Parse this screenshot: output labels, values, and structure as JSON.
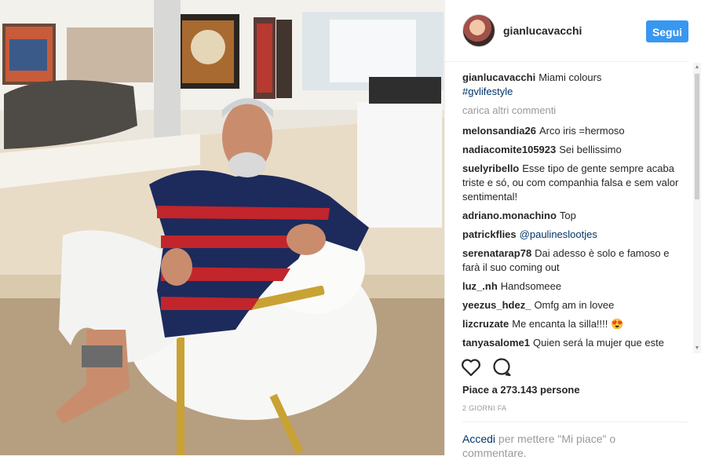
{
  "post": {
    "username": "gianlucavacchi",
    "follow_label": "Segui",
    "caption_user": "gianlucavacchi",
    "caption_text": "Miami colours",
    "caption_hashtag": "#gvlifestyle",
    "load_more": "carica altri commenti",
    "comments": [
      {
        "user": "melonsandia26",
        "text": "Arco iris =hermoso"
      },
      {
        "user": "nadiacomite105923",
        "text": "Sei bellissimo"
      },
      {
        "user": "suelyribello",
        "text": "Esse tipo de gente sempre acaba triste e só, ou com companhia falsa e sem valor sentimental!"
      },
      {
        "user": "adriano.monachino",
        "text": "Top"
      },
      {
        "user": "patrickflies",
        "text": "@paulineslootjes"
      },
      {
        "user": "serenatarap78",
        "text": "Dai adesso è solo e famoso e farà il suo coming out"
      },
      {
        "user": "luz_.nh",
        "text": "Handsomeee"
      },
      {
        "user": "yeezus_hdez_",
        "text": "Omfg am in lovee"
      },
      {
        "user": "lizcruzate",
        "text": "Me encanta la silla!!!! 😍"
      },
      {
        "user": "tanyasalome1",
        "text": "Quien será la mujer que este"
      }
    ],
    "likes": "Piace a 273.143 persone",
    "timestamp": "2 GIORNI FA",
    "login_link": "Accedi",
    "login_text": "per mettere \"Mi piace\" o commentare."
  },
  "icons": [
    "heart-icon",
    "comment-icon"
  ],
  "colors": {
    "accent": "#3897f0",
    "link": "#003569",
    "muted": "#999999",
    "text": "#262626"
  }
}
